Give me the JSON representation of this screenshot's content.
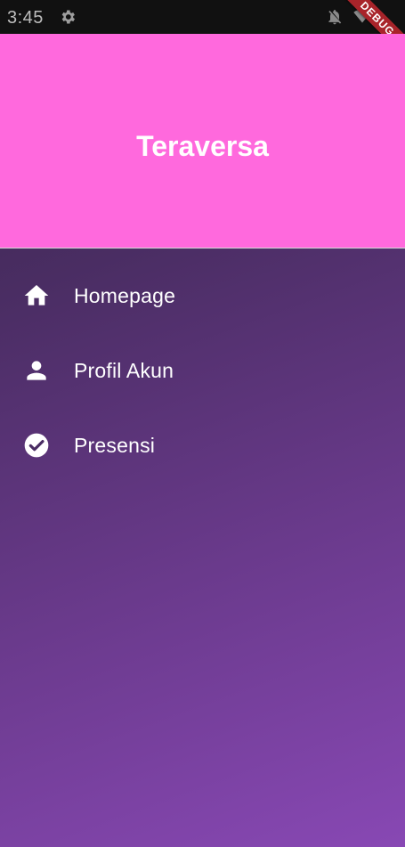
{
  "status_bar": {
    "time": "3:45",
    "icons": [
      "gear-icon",
      "bell-off-icon",
      "wifi-icon"
    ]
  },
  "debug_banner": {
    "label": "DEBUG"
  },
  "drawer": {
    "title": "Teraversa",
    "header_color": "#ff69dd",
    "background_gradient": [
      "#372848",
      "#8848b4"
    ],
    "items": [
      {
        "label": "Homepage",
        "icon": "home-icon"
      },
      {
        "label": "Profil Akun",
        "icon": "person-icon"
      },
      {
        "label": "Presensi",
        "icon": "check-circle-icon"
      }
    ]
  }
}
